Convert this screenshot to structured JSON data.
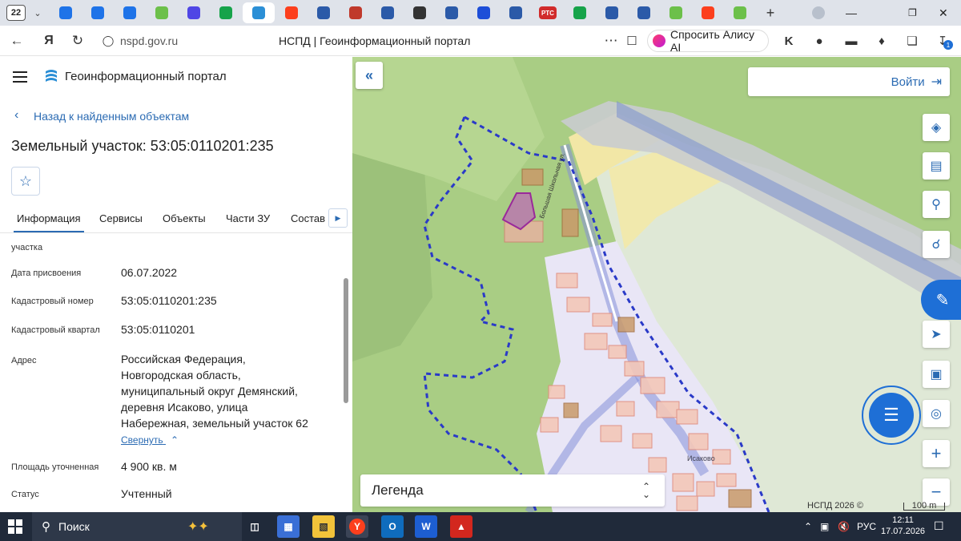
{
  "browser": {
    "tab_count": "22",
    "tabs": [
      {
        "icon": "mail-at-icon",
        "color": "#1e73e8"
      },
      {
        "icon": "mail-icon",
        "color": "#1e73e8"
      },
      {
        "icon": "mail-icon",
        "color": "#1e73e8"
      },
      {
        "icon": "gosuslugi-icon",
        "color": "#6cc04a"
      },
      {
        "icon": "messenger-icon",
        "color": "#4f46e5"
      },
      {
        "icon": "chart-icon",
        "color": "#16a34a"
      },
      {
        "icon": "nspd-icon",
        "color": "#2b8fd6",
        "active": true
      },
      {
        "icon": "yandex-icon",
        "color": "#fc3f1d"
      },
      {
        "icon": "emblem-icon",
        "color": "#2b5aa8"
      },
      {
        "icon": "emblem-icon",
        "color": "#c0392b"
      },
      {
        "icon": "emblem-icon",
        "color": "#2b5aa8"
      },
      {
        "icon": "emblem-icon",
        "color": "#333333"
      },
      {
        "icon": "emblem-icon",
        "color": "#2b5aa8"
      },
      {
        "icon": "flag-icon",
        "color": "#1d4ed8"
      },
      {
        "icon": "emblem-icon",
        "color": "#2b5aa8"
      },
      {
        "icon": "rts-icon",
        "color": "#d12b2b",
        "text": "РТС"
      },
      {
        "icon": "pie-icon",
        "color": "#16a34a"
      },
      {
        "icon": "emblem-icon",
        "color": "#2b5aa8"
      },
      {
        "icon": "emblem-icon",
        "color": "#2b5aa8"
      },
      {
        "icon": "gosuslugi-icon",
        "color": "#6cc04a"
      },
      {
        "icon": "yandex-icon",
        "color": "#fc3f1d"
      },
      {
        "icon": "gosuslugi-icon",
        "color": "#6cc04a"
      }
    ],
    "url": "nspd.gov.ru",
    "page_title": "НСПД | Геоинформационный портал",
    "alice_label": "Спросить Алису AI",
    "download_badge": "1"
  },
  "panel": {
    "portal_title": "Геоинформационный портал",
    "back_link": "Назад к найденным объектам",
    "parcel_title": "Земельный участок: 53:05:0110201:235",
    "tabs": [
      "Информация",
      "Сервисы",
      "Объекты",
      "Части ЗУ",
      "Состав"
    ],
    "fields": {
      "usage_label_partial": "участка",
      "date_label": "Дата присвоения",
      "date_value": "06.07.2022",
      "cadastral_number_label": "Кадастровый номер",
      "cadastral_number_value": "53:05:0110201:235",
      "cadastral_quarter_label": "Кадастровый квартал",
      "cadastral_quarter_value": "53:05:0110201",
      "address_label": "Адрес",
      "address_lines": [
        "Российская Федерация,",
        "Новгородская область,",
        "муниципальный округ Демянский,",
        "деревня Исаково, улица",
        "Набережная, земельный участок 62"
      ],
      "collapse_link": "Свернуть",
      "area_label": "Площадь уточненная",
      "area_value": "4 900 кв. м",
      "status_label": "Статус",
      "status_value": "Учтенный"
    }
  },
  "map": {
    "login_label": "Войти",
    "legend_label": "Легенда",
    "copyright": "НСПД 2026 ©",
    "scale": "100 m",
    "village_label": "Исаково",
    "road_label": "Большая Школьная ул."
  },
  "taskbar": {
    "search_label": "Поиск",
    "language": "РУС",
    "time": "12:11",
    "date": "17.07.2026"
  }
}
